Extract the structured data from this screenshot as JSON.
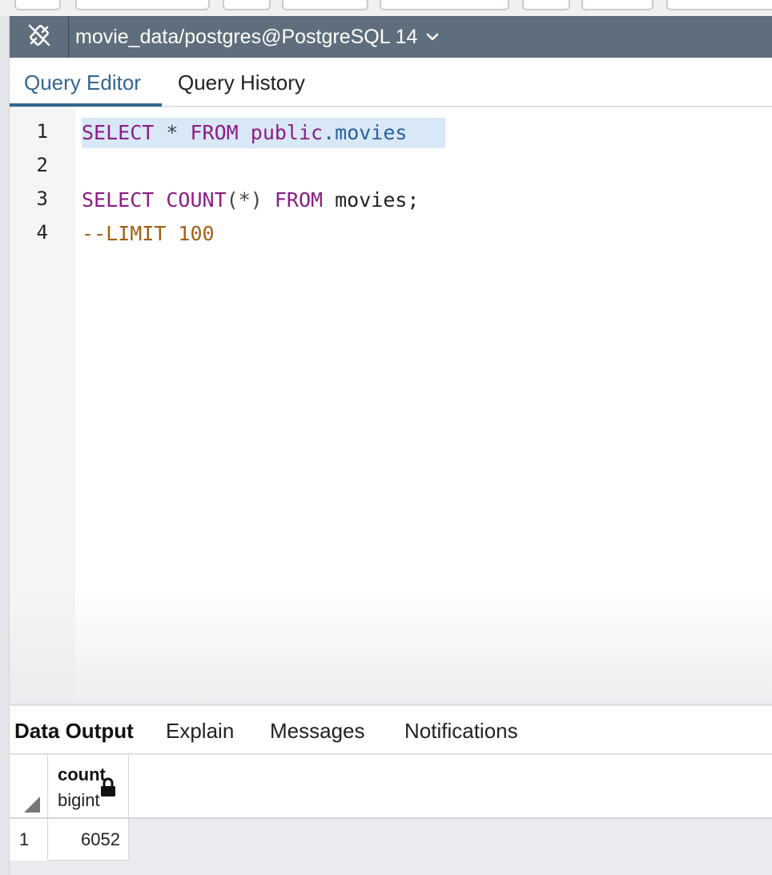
{
  "connection": {
    "label": "movie_data/postgres@PostgreSQL 14"
  },
  "editor_tabs": [
    {
      "label": "Query Editor",
      "active": true
    },
    {
      "label": "Query History",
      "active": false
    }
  ],
  "editor": {
    "line_numbers": [
      "1",
      "2",
      "3",
      "4"
    ],
    "line1": {
      "kw1": "SELECT",
      "star": "*",
      "kw2": "FROM",
      "schema": "public",
      "table": ".movies"
    },
    "line3": {
      "kw1": "SELECT",
      "fn": "COUNT",
      "args": "(*)",
      "kw2": "FROM",
      "rest": " movies;"
    },
    "line4": {
      "comment": "--LIMIT",
      "num": " 100"
    }
  },
  "output_tabs": [
    {
      "label": "Data Output",
      "active": true
    },
    {
      "label": "Explain",
      "active": false
    },
    {
      "label": "Messages",
      "active": false
    },
    {
      "label": "Notifications",
      "active": false
    }
  ],
  "grid": {
    "column": {
      "name": "count",
      "type": "bigint"
    },
    "rows": [
      {
        "num": "1",
        "value": "6052"
      }
    ]
  },
  "colors": {
    "conn_bar": "#5f6e7c",
    "active_tab": "#326690",
    "keyword": "#8b1d86",
    "property": "#2a5f9e",
    "comment": "#a25f17",
    "selection": "#d8e8f6"
  },
  "icons": {
    "connection": "disconnected-plug-icon",
    "dropdown": "chevron-down-icon",
    "lock": "lock-icon",
    "sort": "corner-triangle-icon"
  }
}
